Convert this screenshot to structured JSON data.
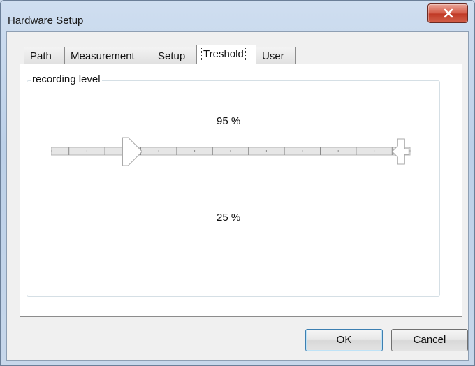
{
  "window": {
    "title": "Hardware Setup"
  },
  "tabs": [
    {
      "label": "Path"
    },
    {
      "label": "Measurement"
    },
    {
      "label": "Setup"
    },
    {
      "label": "Treshold",
      "active": true
    },
    {
      "label": "User"
    }
  ],
  "threshold": {
    "group_label": "recording level",
    "upper_label": "95 %",
    "lower_label": "25 %",
    "upper_value_percent": 95,
    "lower_value_percent": 25
  },
  "buttons": {
    "ok": "OK",
    "cancel": "Cancel"
  }
}
